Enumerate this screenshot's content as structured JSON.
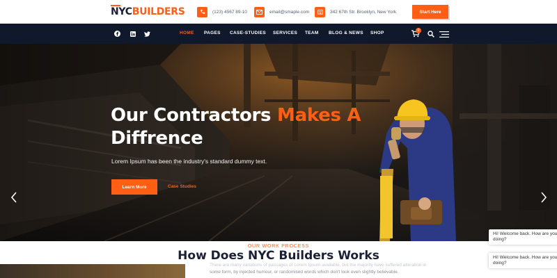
{
  "header": {
    "logo_part1": "NYC",
    "logo_part2": "BUILDERS",
    "phone": "(123) 4567 89-10",
    "email": "email@smaple.com",
    "address": "342 67th Str. Brooklyn, New York",
    "cta_label": "Start Here"
  },
  "nav": {
    "social_icons": [
      "facebook-icon",
      "linkedin-icon",
      "twitter-icon"
    ],
    "items": [
      "HOME",
      "PAGES",
      "CASE-STUDIES",
      "SERVICES",
      "TEAM",
      "BLOG & NEWS",
      "SHOP"
    ],
    "active_index": 0,
    "cart_count": "0"
  },
  "hero": {
    "title_white1": "Our Contractors",
    "title_orange": "Makes A",
    "title_white2": "Diffrence",
    "subtitle": "Lorem Ipsum has been the industry's standard dummy text.",
    "primary_btn": "Learn More",
    "secondary_link": "Case Studies"
  },
  "section": {
    "eyebrow": "OUR WORK PROCESS",
    "title": "How Does NYC Builders Works",
    "body_line1": "There are many variations of passages of Lorem Ipsum available, but the majority have suffered alteration in",
    "body_line2": "some form, by injected humour, or randomised words which don't look even slightly believable."
  },
  "chat": {
    "message": "Hi! Welcome back. How are you doing?"
  },
  "colors": {
    "accent": "#ff5e14",
    "navy": "#10182b"
  }
}
